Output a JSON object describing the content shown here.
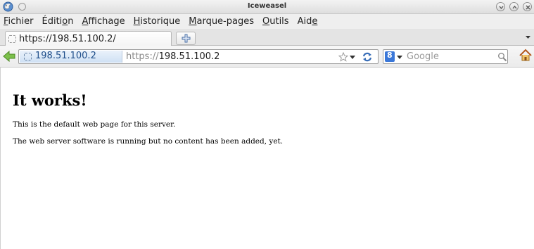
{
  "window": {
    "title": "Iceweasel"
  },
  "menu": {
    "items": [
      {
        "label": "Fichier",
        "mnemonic_index": 0
      },
      {
        "label": "Édition",
        "mnemonic_index": 5
      },
      {
        "label": "Affichage",
        "mnemonic_index": 0
      },
      {
        "label": "Historique",
        "mnemonic_index": 0
      },
      {
        "label": "Marque-pages",
        "mnemonic_index": 0
      },
      {
        "label": "Outils",
        "mnemonic_index": 0
      },
      {
        "label": "Aide",
        "mnemonic_index": 3
      }
    ]
  },
  "tabs": [
    {
      "label": "https://198.51.100.2/",
      "active": true
    }
  ],
  "navbar": {
    "identity_label": "198.51.100.2",
    "url_scheme": "https://",
    "url_host": "198.51.100.2",
    "search_placeholder": "Google"
  },
  "page": {
    "heading": "It works!",
    "paragraphs": [
      "This is the default web page for this server.",
      "The web server software is running but no content has been added, yet."
    ]
  },
  "colors": {
    "identity_text": "#1f4e8a",
    "back_arrow": "#6db33f",
    "search_engine": "#3a77d8"
  }
}
